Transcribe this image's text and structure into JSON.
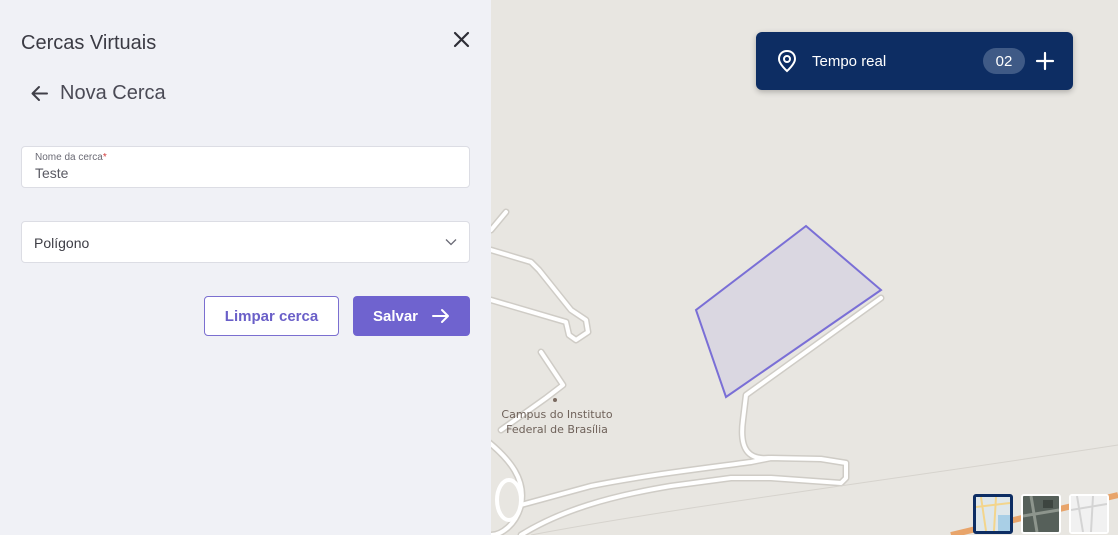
{
  "sidebar": {
    "title": "Cercas Virtuais",
    "subtitle": "Nova Cerca",
    "name_field": {
      "label": "Nome da cerca",
      "required_mark": "*",
      "value": "Teste"
    },
    "shape_select": {
      "value": "Polígono"
    },
    "clear_label": "Limpar cerca",
    "save_label": "Salvar"
  },
  "realtime": {
    "label": "Tempo real",
    "count": "02"
  },
  "map": {
    "poi_label_line1": "Campus do Instituto",
    "poi_label_line2": "Federal de Brasília"
  },
  "colors": {
    "accent": "#6f63cf",
    "navy": "#0d2d63",
    "fence_stroke": "#7a6fd6"
  }
}
